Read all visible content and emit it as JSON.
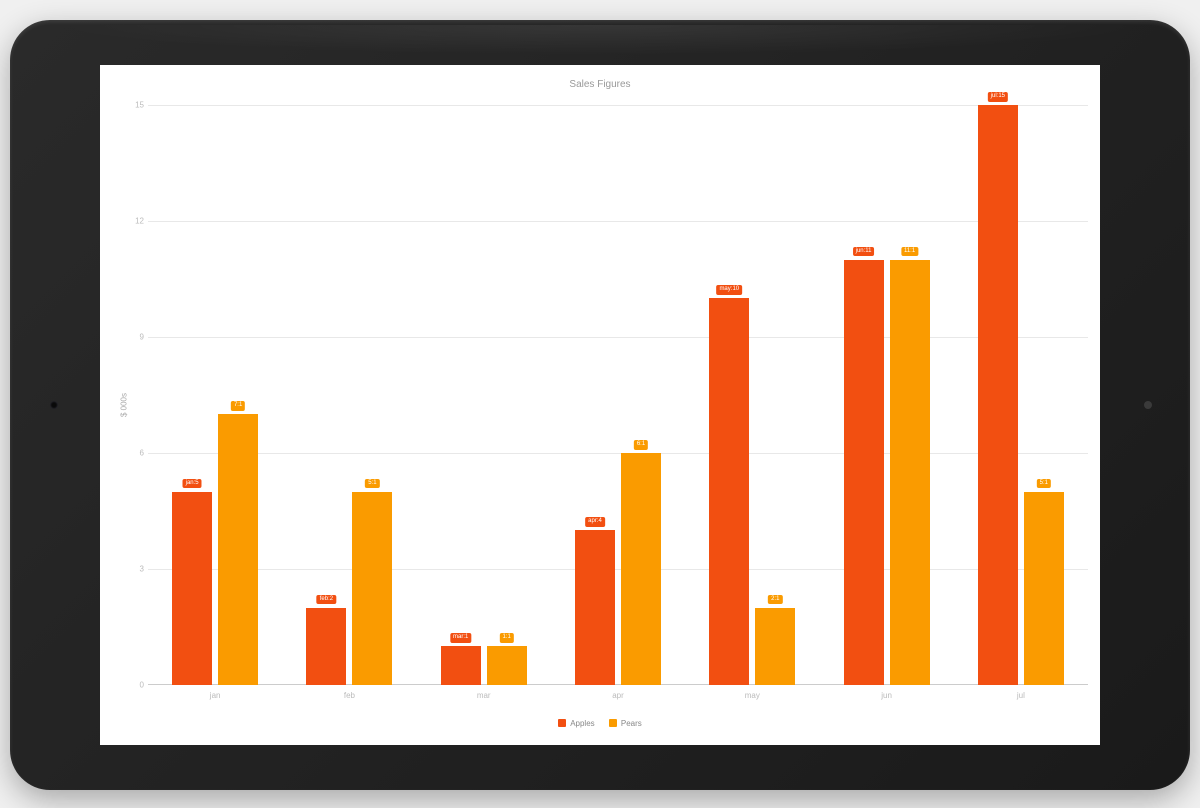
{
  "chart_data": {
    "type": "bar",
    "title": "Sales Figures",
    "ylabel": "$ 000s",
    "xlabel": "",
    "categories": [
      "jan",
      "feb",
      "mar",
      "apr",
      "may",
      "jun",
      "jul"
    ],
    "series": [
      {
        "name": "Apples",
        "color": "#f24f11",
        "values": [
          5,
          2,
          1,
          4,
          10,
          11,
          15
        ]
      },
      {
        "name": "Pears",
        "color": "#fa9b00",
        "values": [
          7,
          5,
          1,
          6,
          2,
          11,
          5
        ]
      }
    ],
    "y_ticks": [
      0,
      3,
      6,
      9,
      12,
      15
    ],
    "ylim": [
      0,
      15
    ],
    "legend_position": "bottom"
  },
  "bar_labels": {
    "apples": [
      "jan:5",
      "feb:2",
      "mar:1",
      "apr:4",
      "may:10",
      "jun:11",
      "jul:15"
    ],
    "pears": [
      "7:1",
      "5:1",
      "1:1",
      "6:1",
      "2:1",
      "11:1",
      "5:1"
    ]
  }
}
